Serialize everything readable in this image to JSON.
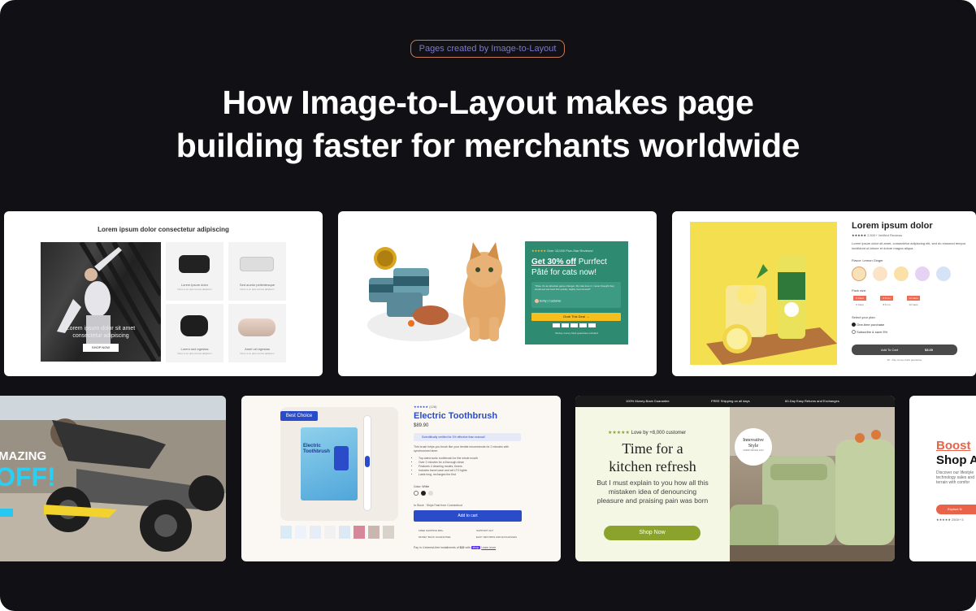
{
  "badge": "Pages created by Image-to-Layout",
  "headline": {
    "line1": "How Image-to-Layout makes page",
    "line2": "building faster for merchants worldwide"
  },
  "card1": {
    "title": "Lorem ipsum dolor consectetur adipiscing",
    "hero_caption_1": "Lorem ipsum dolor sit amet",
    "hero_caption_2": "consectetur adipiscing",
    "hero_button": "SHOP NOW",
    "products": [
      {
        "name": "Lorem ipsum dolor",
        "sub": "Nunc a ex quis cursus adipiscin"
      },
      {
        "name": "Sed auctor pellentesque",
        "sub": "Nunc a ex quis cursus adipiscin"
      },
      {
        "name": "Lorem sed egestas",
        "sub": "Nunc a ex quis cursus adipiscin"
      },
      {
        "name": "Amet vel egestas",
        "sub": "Nunc a ex quis cursus adipiscin"
      }
    ]
  },
  "card2": {
    "stars": "★★★★★",
    "rating_text": "Over 10,000 Five-Star Reviews!",
    "headline_underlined": "Get 30% off",
    "headline_rest": " Purrfect",
    "headline_line2": "Pâté for cats now!",
    "quote": "\"Wow, it's an absolute game changer. My cats love it. I never thought they would eat wet food this quickly. Highly recommend!\"",
    "reviewer": "Emily | Customer",
    "cta": "Grab This Deal →",
    "guarantee": "90-day money back guarantee included"
  },
  "card3": {
    "title": "Lorem ipsum dolor",
    "stars": "★★★★★",
    "reviews": "2,500+ Verified Reviews",
    "desc": "Lorem ipsum dolor sit amet, consectetur adipiscing elit, sed do eiusmod tempor incididunt ut labore et dolore magna aliqua.",
    "flavor_label": "Flavor: Lemon Ginger",
    "pack_label": "Pack size:",
    "packs": [
      "6 Cans",
      "8.5 cm",
      "12 Cans"
    ],
    "packs_bottom": [
      "6 Cans",
      "8.5 cm",
      "12 Cans"
    ],
    "plan_label": "Select your plan",
    "plan_onetime": "One-time purchase",
    "plan_subscribe": "Subscribe & save 5%",
    "add_to_cart": "Add To Cart",
    "price": "$3.00",
    "guarantee": "30 - Day money back guarantee"
  },
  "card4": {
    "line1": "MAZING",
    "line2": "OFF!"
  },
  "card5": {
    "badge": "Best Choice",
    "stars": "★★★★★",
    "reviews": "(128)",
    "title": "Electric Toothbrush",
    "price": "$89.90",
    "verified": "Scientifically verified for 3% effective than manual!",
    "desc": "This brush helps you brush like your dentist recommends for 2 minutes with synchronized timer.",
    "bullets": [
      "Top-rated sonic toothbrush for the whole mouth",
      "Over 2 minutes for a thorough clean",
      "Features 4 cleaning modes, timers",
      "Includes travel case and wit LTO lights",
      "Lasts long, recharges the first"
    ],
    "color_label": "Color: White",
    "stock": "In Stock · Ships Fast from Connecticut",
    "add_to_cart": "Add to cart",
    "features": [
      "FREE SHIPPING $50+",
      "SUPPORT 24/7",
      "MONEY BACK GUARANTEE",
      "EASY RETURNS AND EXCHANGES"
    ],
    "installment": "Pay in 4 interest-free installments of",
    "installment_amount": "$22",
    "installment_with": "with",
    "shop_label": "shop",
    "learn_more": "Learn more"
  },
  "card6": {
    "bar": [
      "100% Money-Back Guarantee",
      "FREE Shipping on all days",
      "60-Day Easy Returns and Exchanges"
    ],
    "stars": "★★★★★",
    "loved": "Love by +8,000 customer",
    "title_line1": "Time for a",
    "title_line2": "kitchen refresh",
    "body": "But I must explain to you how all this mistaken idea of denouncing pleasure and praising pain was born",
    "cta": "Shop Now",
    "badge_line1": "Innovative",
    "badge_line2": "Style",
    "badge_sub": "FRESH DESIGN 2024"
  },
  "card7": {
    "title_line1": "Boost",
    "title_line2": "Shop A",
    "body": "Discover our lifestyle technology sales and terrain with comfor",
    "cta": "Explore N",
    "rating": "★★★★★ 2500+ 5"
  },
  "colors": {
    "background": "#111014",
    "badge_border": "#c97a55",
    "badge_text": "#7c79c9",
    "teal": "#2e8b72",
    "primary_blue": "#2b4cc8",
    "olive": "#8ba32a",
    "coral": "#e9634a"
  }
}
